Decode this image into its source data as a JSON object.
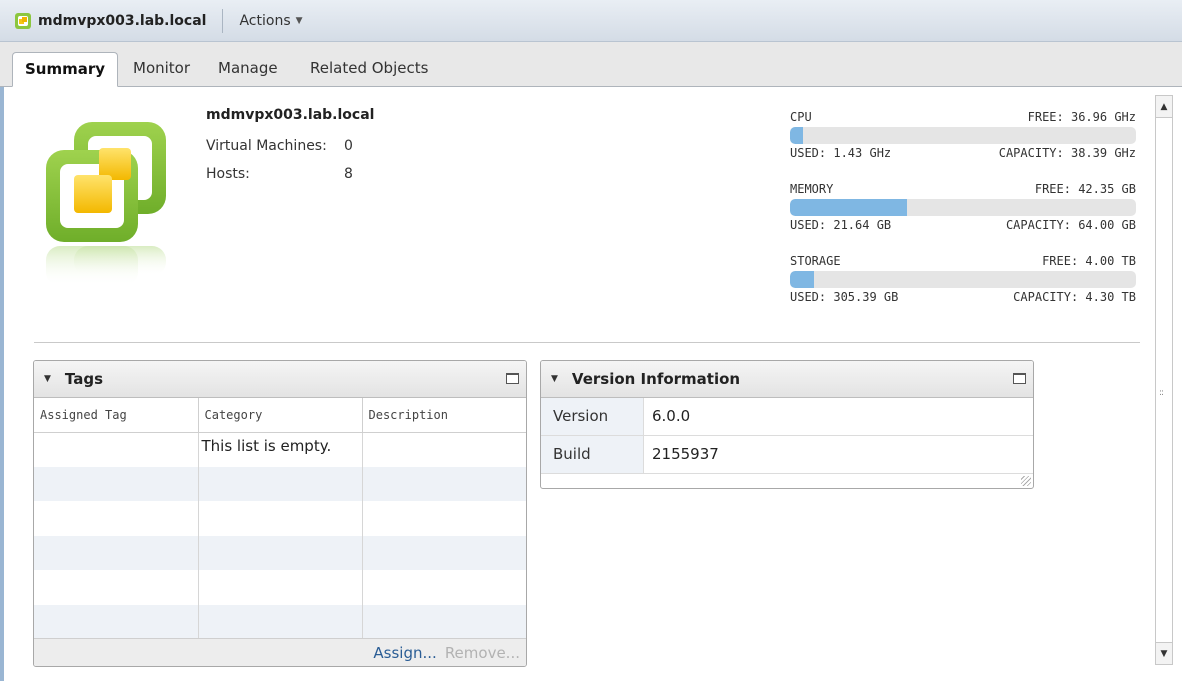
{
  "titlebar": {
    "object_name": "mdmvpx003.lab.local",
    "actions_label": "Actions"
  },
  "tabs": [
    {
      "label": "Summary",
      "active": true
    },
    {
      "label": "Monitor",
      "active": false
    },
    {
      "label": "Manage",
      "active": false
    },
    {
      "label": "Related Objects",
      "active": false
    }
  ],
  "summary": {
    "name": "mdmvpx003.lab.local",
    "virtual_machines_label": "Virtual Machines:",
    "virtual_machines_value": "0",
    "hosts_label": "Hosts:",
    "hosts_value": "8"
  },
  "meters": [
    {
      "label": "CPU",
      "free": "FREE: 36.96 GHz",
      "used": "USED: 1.43 GHz",
      "capacity": "CAPACITY: 38.39 GHz",
      "fraction": 0.037
    },
    {
      "label": "MEMORY",
      "free": "FREE: 42.35 GB",
      "used": "USED: 21.64 GB",
      "capacity": "CAPACITY: 64.00 GB",
      "fraction": 0.338
    },
    {
      "label": "STORAGE",
      "free": "FREE: 4.00 TB",
      "used": "USED: 305.39 GB",
      "capacity": "CAPACITY: 4.30 TB",
      "fraction": 0.069
    }
  ],
  "tags_portlet": {
    "title": "Tags",
    "columns": [
      "Assigned Tag",
      "Category",
      "Description"
    ],
    "empty_message": "This list is empty.",
    "assign_label": "Assign...",
    "remove_label": "Remove..."
  },
  "version_portlet": {
    "title": "Version Information",
    "rows": [
      {
        "key": "Version",
        "value": "6.0.0"
      },
      {
        "key": "Build",
        "value": "2155937"
      }
    ]
  },
  "colors": {
    "meter_fill": "#7fb7e3",
    "link": "#2a5d95",
    "icon_green": "#8cc63f",
    "icon_yellow": "#f5c518"
  }
}
